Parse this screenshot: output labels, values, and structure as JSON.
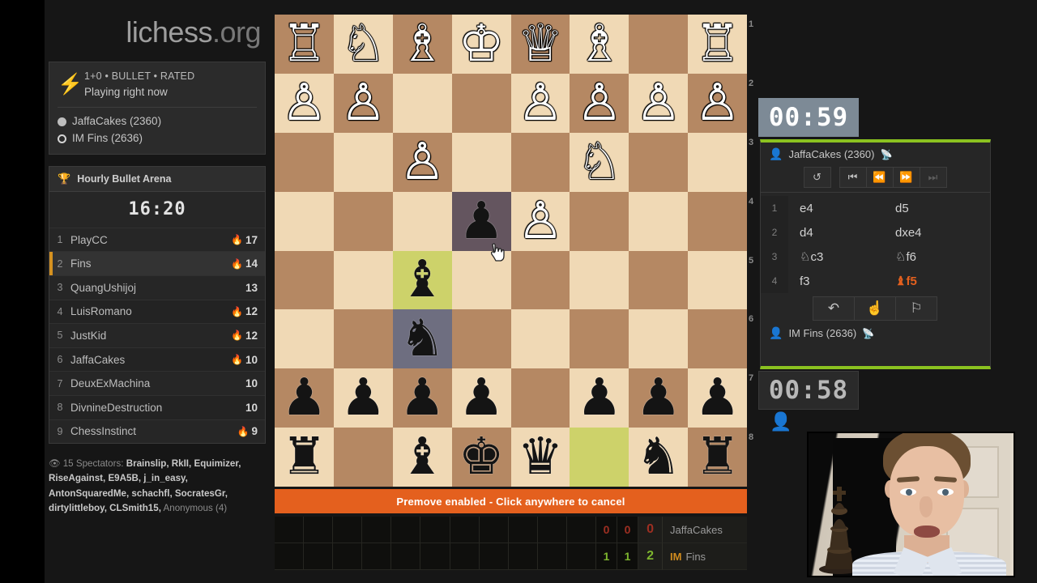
{
  "site": {
    "name_main": "lichess",
    "name_tld": ".org"
  },
  "game_info": {
    "icon": "bolt-icon",
    "time_control_line": "1+0 • BULLET • RATED",
    "status": "Playing right now",
    "white_player": "JaffaCakes (2360)",
    "black_player": "IM Fins (2636)"
  },
  "tournament": {
    "icon": "trophy-icon",
    "name": "Hourly Bullet Arena",
    "clock": "16:20",
    "leaders": [
      {
        "rank": "1",
        "name": "PlayCC",
        "score": "17",
        "fire": true
      },
      {
        "rank": "2",
        "name": "Fins",
        "score": "14",
        "fire": true,
        "is_me": true
      },
      {
        "rank": "3",
        "name": "QuangUshijoj",
        "score": "13",
        "fire": false
      },
      {
        "rank": "4",
        "name": "LuisRomano",
        "score": "12",
        "fire": true
      },
      {
        "rank": "5",
        "name": "JustKid",
        "score": "12",
        "fire": true
      },
      {
        "rank": "6",
        "name": "JaffaCakes",
        "score": "10",
        "fire": true
      },
      {
        "rank": "7",
        "name": "DeuxExMachina",
        "score": "10",
        "fire": false
      },
      {
        "rank": "8",
        "name": "DivnineDestruction",
        "score": "10",
        "fire": false
      },
      {
        "rank": "9",
        "name": "ChessInstinct",
        "score": "9",
        "fire": true
      }
    ]
  },
  "spectators": {
    "icon": "eye-icon",
    "label": "15 Spectators:",
    "names": "Brainslip, RkII, Equimizer, RiseAgainst, E9A5B, j_in_easy, AntonSquaredMe, schachfl, SocratesGr, dirtylittleboy, CLSmith15,",
    "anonymous": "Anonymous (4)"
  },
  "board": {
    "orientation": "black",
    "rank_coords": [
      "1",
      "2",
      "3",
      "4",
      "5",
      "6",
      "7",
      "8"
    ],
    "colors": {
      "light": "#f0d9b5",
      "dark": "#b58863",
      "last_move": "#cdd26a",
      "premove": "#6e6e80"
    },
    "premove_banner": "Premove enabled - Click anywhere to cancel",
    "pieces": [
      {
        "sq": "a1",
        "piece": "white-rook"
      },
      {
        "sq": "b1",
        "piece": "white-knight"
      },
      {
        "sq": "c1",
        "piece": "white-bishop"
      },
      {
        "sq": "d1",
        "piece": "white-king"
      },
      {
        "sq": "e1",
        "piece": "white-queen"
      },
      {
        "sq": "f1",
        "piece": "white-bishop"
      },
      {
        "sq": "h1",
        "piece": "white-rook"
      },
      {
        "sq": "a2",
        "piece": "white-pawn"
      },
      {
        "sq": "b2",
        "piece": "white-pawn"
      },
      {
        "sq": "e2",
        "piece": "white-pawn"
      },
      {
        "sq": "f2",
        "piece": "white-pawn"
      },
      {
        "sq": "g2",
        "piece": "white-pawn"
      },
      {
        "sq": "h2",
        "piece": "white-pawn"
      },
      {
        "sq": "c3",
        "piece": "white-pawn"
      },
      {
        "sq": "f3",
        "piece": "white-knight"
      },
      {
        "sq": "d4",
        "piece": "black-pawn"
      },
      {
        "sq": "e4",
        "piece": "white-pawn"
      },
      {
        "sq": "c5",
        "piece": "black-bishop"
      },
      {
        "sq": "c6",
        "piece": "black-knight"
      },
      {
        "sq": "a7",
        "piece": "black-pawn"
      },
      {
        "sq": "b7",
        "piece": "black-pawn"
      },
      {
        "sq": "c7",
        "piece": "black-pawn"
      },
      {
        "sq": "d7",
        "piece": "black-pawn"
      },
      {
        "sq": "f7",
        "piece": "black-pawn"
      },
      {
        "sq": "g7",
        "piece": "black-pawn"
      },
      {
        "sq": "h7",
        "piece": "black-pawn"
      },
      {
        "sq": "a8",
        "piece": "black-rook"
      },
      {
        "sq": "c8",
        "piece": "black-bishop"
      },
      {
        "sq": "d8",
        "piece": "black-king"
      },
      {
        "sq": "e8",
        "piece": "black-queen"
      },
      {
        "sq": "g8",
        "piece": "black-knight"
      },
      {
        "sq": "h8",
        "piece": "black-rook"
      }
    ],
    "highlight_last_move": [
      "c5",
      "f8"
    ],
    "highlight_premove": [
      "d4",
      "c6"
    ]
  },
  "clocks": {
    "top": "00:59",
    "bottom": "00:58"
  },
  "move_panel": {
    "top_player": {
      "name": "JaffaCakes (2360)",
      "icon": "user-icon",
      "stream_icon": "rss-icon"
    },
    "bottom_player": {
      "name": "IM Fins (2636)",
      "icon": "user-icon",
      "stream_icon": "rss-icon"
    },
    "nav": {
      "flip": "flip-board-icon",
      "first": "first-move-icon",
      "prev": "previous-move-icon",
      "next": "next-move-icon",
      "last": "last-move-icon"
    },
    "actions": {
      "takeback": "takeback-icon",
      "draw": "offer-draw-icon",
      "resign": "resign-flag-icon"
    },
    "moves": [
      {
        "num": "1",
        "white": "e4",
        "black": "d5"
      },
      {
        "num": "2",
        "white": "d4",
        "black": "dxe4"
      },
      {
        "num": "3",
        "white": "♘c3",
        "black": "♘f6"
      },
      {
        "num": "4",
        "white": "f3",
        "black": "♝f5",
        "black_current": true
      }
    ]
  },
  "score_strip": {
    "rows": [
      {
        "player": "JaffaCakes",
        "title": "",
        "points": [
          "0",
          "0"
        ],
        "total": "0",
        "color": "red"
      },
      {
        "player": "Fins",
        "title": "IM",
        "points": [
          "1",
          "1"
        ],
        "total": "2",
        "color": "green"
      }
    ],
    "empty_cells": 11
  },
  "webcam": {
    "present": true,
    "label": "streamer-webcam"
  }
}
